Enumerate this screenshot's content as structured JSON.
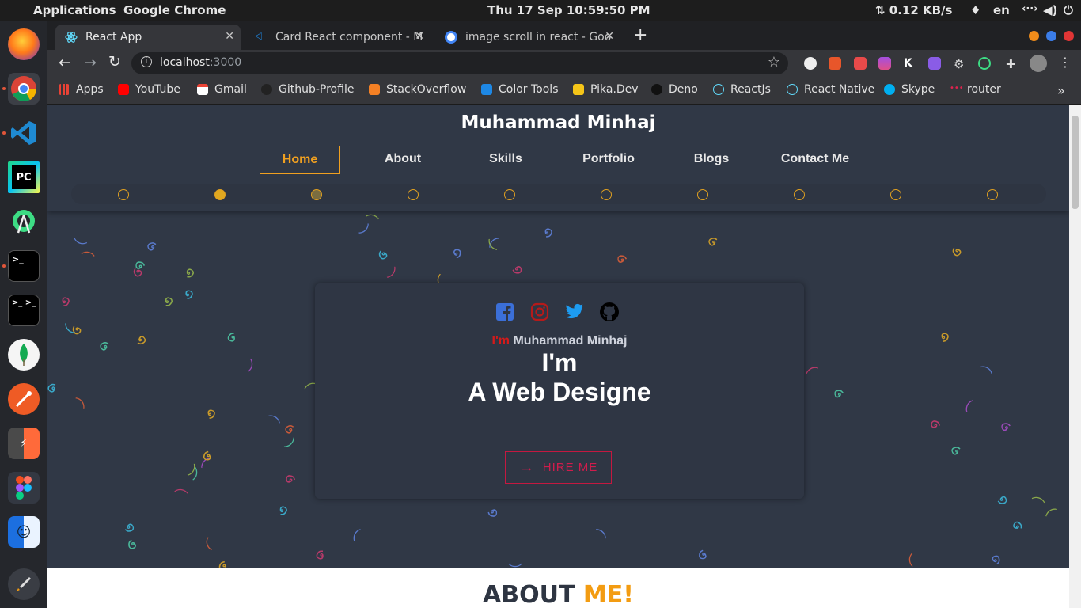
{
  "system": {
    "apps_menu": "Applications",
    "active_app": "Google Chrome",
    "clock": "Thu 17 Sep  10:59:50 PM",
    "network": "⇅ 0.12 KB/s",
    "lang": "en"
  },
  "dock": {
    "items": [
      "firefox",
      "chrome",
      "vscode",
      "pycharm",
      "android-studio",
      "terminal",
      "terminator",
      "mongodb",
      "postman",
      "sublime-merge",
      "figma",
      "finder",
      "launcher"
    ]
  },
  "browser": {
    "tabs": [
      {
        "title": "React App",
        "active": true
      },
      {
        "title": "Card React component - M",
        "active": false
      },
      {
        "title": "image scroll in react - Goo",
        "active": false
      }
    ],
    "new_tab": "+",
    "url_host": "localhost",
    "url_port": ":3000",
    "bookmarks": [
      "Apps",
      "YouTube",
      "Gmail",
      "Github-Profile",
      "StackOverflow",
      "Color Tools",
      "Pika.Dev",
      "Deno",
      "ReactJs",
      "React Native",
      "Skype",
      "router"
    ],
    "bookmarks_more": "»"
  },
  "site": {
    "brand": "Muhammad Minhaj",
    "nav": [
      "Home",
      "About",
      "Skills",
      "Portfolio",
      "Blogs",
      "Contact Me"
    ],
    "active_nav": "Home",
    "slider_dots": 10,
    "slider_active_index": 1,
    "intro_prefix": "I'm",
    "intro_name": "Muhammad Minhaj",
    "headline_1": "I'm",
    "headline_2": "A Web Designe",
    "hire_label": "HIRE ME",
    "about_title": "ABOUT",
    "about_accent": "ME!",
    "colors": {
      "accent": "#f0a020",
      "hire": "#d01c4c",
      "background": "#303846"
    }
  }
}
